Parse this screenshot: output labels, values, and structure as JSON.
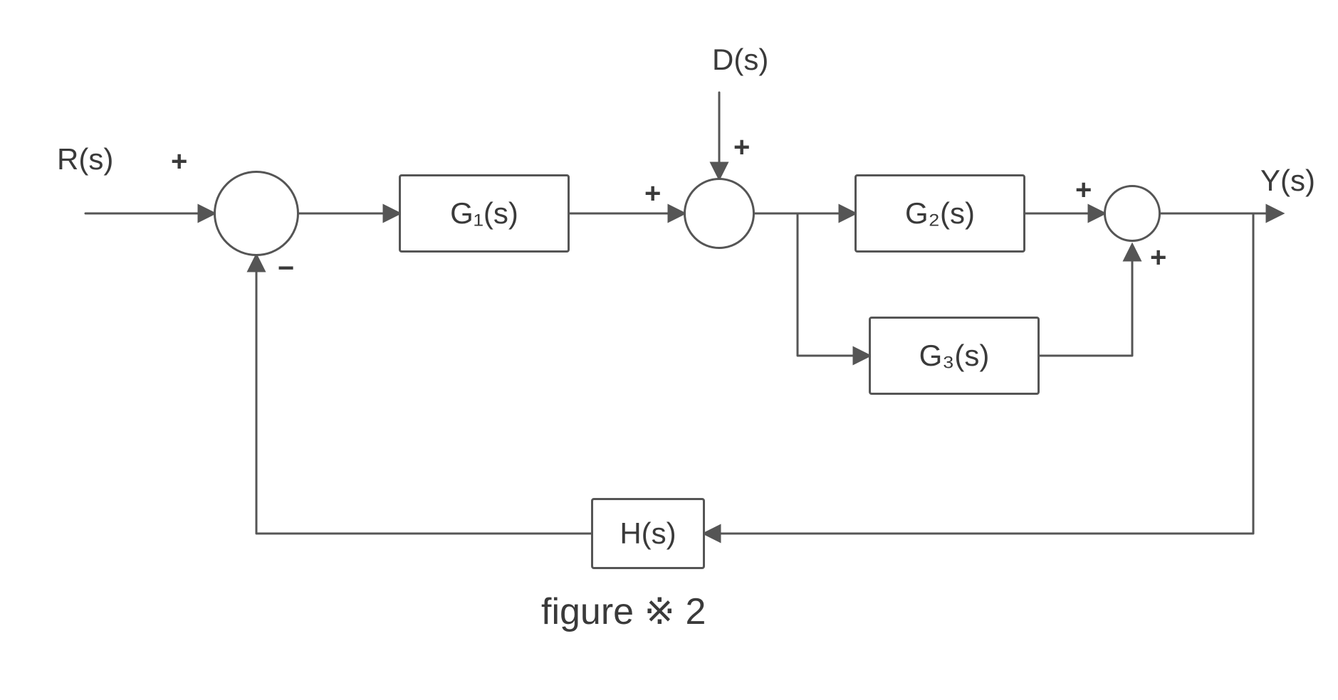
{
  "inputs": {
    "reference": "R(s)",
    "disturbance": "D(s)",
    "output": "Y(s)"
  },
  "blocks": {
    "g1": "G₁(s)",
    "g2": "G₂(s)",
    "g3": "G₃(s)",
    "h": "H(s)"
  },
  "signs": {
    "sum1_top": "+",
    "sum1_bottom": "−",
    "sum2_left": "+",
    "sum2_top": "+",
    "sum3_top": "+",
    "sum3_bottom": "+"
  },
  "caption": "figure ※ 2",
  "diagram": {
    "type": "block-diagram",
    "description": "Control system block diagram with reference input R(s), disturbance D(s), output Y(s), forward-path blocks G1, G2 in parallel with G3, and feedback block H(s).",
    "nodes": [
      {
        "id": "R",
        "kind": "input",
        "label": "R(s)"
      },
      {
        "id": "D",
        "kind": "input",
        "label": "D(s)"
      },
      {
        "id": "Y",
        "kind": "output",
        "label": "Y(s)"
      },
      {
        "id": "sum1",
        "kind": "sum",
        "inputs": {
          "R": "+",
          "H_out": "-"
        }
      },
      {
        "id": "G1",
        "kind": "block",
        "tf": "G1(s)"
      },
      {
        "id": "sum2",
        "kind": "sum",
        "inputs": {
          "G1_out": "+",
          "D": "+"
        }
      },
      {
        "id": "G2",
        "kind": "block",
        "tf": "G2(s)"
      },
      {
        "id": "G3",
        "kind": "block",
        "tf": "G3(s)"
      },
      {
        "id": "sum3",
        "kind": "sum",
        "inputs": {
          "G2_out": "+",
          "G3_out": "+"
        }
      },
      {
        "id": "H",
        "kind": "block",
        "tf": "H(s)"
      }
    ],
    "edges": [
      {
        "from": "R",
        "to": "sum1"
      },
      {
        "from": "sum1",
        "to": "G1"
      },
      {
        "from": "G1",
        "to": "sum2"
      },
      {
        "from": "D",
        "to": "sum2"
      },
      {
        "from": "sum2",
        "to": "G2"
      },
      {
        "from": "sum2",
        "to": "G3"
      },
      {
        "from": "G2",
        "to": "sum3"
      },
      {
        "from": "G3",
        "to": "sum3"
      },
      {
        "from": "sum3",
        "to": "Y"
      },
      {
        "from": "Y",
        "to": "H"
      },
      {
        "from": "H",
        "to": "sum1"
      }
    ]
  }
}
